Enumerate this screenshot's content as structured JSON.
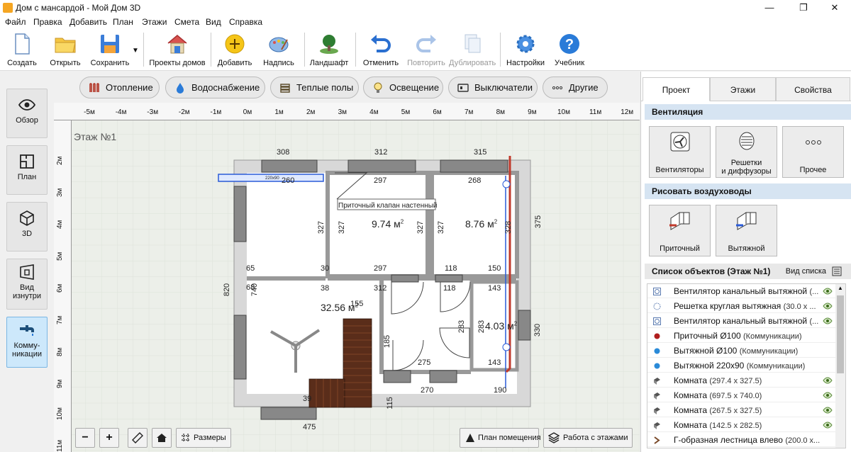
{
  "window": {
    "title": "Дом с мансардой - Мой Дом 3D",
    "minimize": "—",
    "maximize": "❐",
    "close": "✕"
  },
  "menu": [
    "Файл",
    "Правка",
    "Добавить",
    "План",
    "Этажи",
    "Смета",
    "Вид",
    "Справка"
  ],
  "toolbar": {
    "create": "Создать",
    "open": "Открыть",
    "save": "Сохранить",
    "house_projects": "Проекты домов",
    "add": "Добавить",
    "label": "Надпись",
    "landscape": "Ландшафт",
    "undo": "Отменить",
    "redo": "Повторить",
    "duplicate": "Дублировать",
    "settings": "Настройки",
    "tutorial": "Учебник"
  },
  "left_panel": {
    "overview": "Обзор",
    "plan": "План",
    "view3d": "3D",
    "inside_line1": "Вид",
    "inside_line2": "изнутри",
    "comm_line1": "Комму-",
    "comm_line2": "никации"
  },
  "comm_bar": {
    "heating": "Отопление",
    "water": "Водоснабжение",
    "floor": "Теплые полы",
    "lighting": "Освещение",
    "switches": "Выключатели",
    "other": "Другие"
  },
  "canvas": {
    "floor_label": "Этаж №1",
    "ruler_top": [
      "-5м",
      "-4м",
      "-3м",
      "-2м",
      "-1м",
      "0м",
      "1м",
      "2м",
      "3м",
      "4м",
      "5м",
      "6м",
      "7м",
      "8м",
      "9м",
      "10м",
      "11м",
      "12м"
    ],
    "ruler_left": [
      "2м",
      "3м",
      "4м",
      "5м",
      "6м",
      "7м",
      "8м",
      "9м",
      "10м",
      "11м"
    ],
    "dims": {
      "d308": "308",
      "d312a": "312",
      "d315": "315",
      "d260": "260",
      "d297a": "297",
      "d268": "268",
      "d327a": "327",
      "d327b": "327",
      "d327c": "327",
      "d327d": "327",
      "d328": "328",
      "d375": "375",
      "d65": "65",
      "d30": "30",
      "d297b": "297",
      "d118a": "118",
      "d150": "150",
      "d820": "820",
      "d68": "68",
      "d740": "740",
      "d38": "38",
      "d312b": "312",
      "d118b": "118",
      "d143a": "143",
      "d155": "155",
      "d283a": "283",
      "d283b": "283",
      "d330": "330",
      "d185": "185",
      "d275": "275",
      "d143b": "143",
      "d270": "270",
      "d190": "190",
      "d39": "39",
      "d115": "115",
      "d475": "475"
    },
    "areas": {
      "a1": "9.74 м",
      "a2": "8.76 м",
      "a3": "32.56 м",
      "a4": "4.03 м",
      "sup": "2"
    },
    "tooltip": "Приточный клапан настенный",
    "duct_label": "220x90",
    "zoom_out": "−",
    "zoom_in": "+",
    "sizes": "Размеры",
    "room_plan": "План помещения",
    "floors_work": "Работа с этажами"
  },
  "right_panel": {
    "tabs": [
      "Проект",
      "Этажи",
      "Свойства"
    ],
    "ventilation": "Вентиляция",
    "fans": "Вентиляторы",
    "grilles_line1": "Решетки",
    "grilles_line2": "и диффузоры",
    "other": "Прочее",
    "draw_ducts": "Рисовать воздуховоды",
    "supply": "Приточный",
    "exhaust": "Вытяжной",
    "objects_header": "Список объектов (Этаж №1)",
    "list_view": "Вид списка",
    "objects": [
      {
        "name": "Вентилятор канальный вытяжной",
        "detail": "(..."
      },
      {
        "name": "Решетка круглая вытяжная",
        "detail": "(30.0 x ..."
      },
      {
        "name": "Вентилятор канальный вытяжной",
        "detail": "(..."
      },
      {
        "name": "Приточный Ø100",
        "detail": "(Коммуникации)"
      },
      {
        "name": "Вытяжной Ø100",
        "detail": "(Коммуникации)"
      },
      {
        "name": "Вытяжной 220x90",
        "detail": "(Коммуникации)"
      },
      {
        "name": "Комната",
        "detail": "(297.4 x 327.5)"
      },
      {
        "name": "Комната",
        "detail": "(697.5 x 740.0)"
      },
      {
        "name": "Комната",
        "detail": "(267.5 x 327.5)"
      },
      {
        "name": "Комната",
        "detail": "(142.5 x 282.5)"
      },
      {
        "name": "Г-образная лестница влево",
        "detail": "(200.0 x..."
      }
    ]
  },
  "colors": {
    "accent": "#0078d7",
    "supply_red": "#c0392b",
    "exhaust_blue": "#2a5bd7",
    "selected": "#cde8fb",
    "header": "#d6e4f2",
    "stairs": "#5a2d1a"
  }
}
